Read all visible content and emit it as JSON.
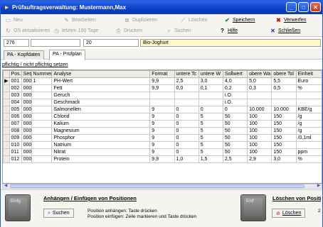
{
  "window": {
    "title": "Prüfauftragsverwaltung:  Mustermann,Max"
  },
  "toolbar": {
    "row1": [
      {
        "label": "Neu",
        "icon": "new-icon",
        "enabled": false
      },
      {
        "label": "Bearbeiten",
        "icon": "edit-icon",
        "enabled": false
      },
      {
        "label": "Duplizieren",
        "icon": "duplicate-icon",
        "enabled": false
      },
      {
        "label": "Löschen",
        "icon": "delete-icon",
        "enabled": false
      },
      {
        "label": "Speichern",
        "icon": "checkmark-icon",
        "enabled": true
      },
      {
        "label": "Verwerfen",
        "icon": "discard-icon",
        "enabled": true
      }
    ],
    "row2": [
      {
        "label": "OS aktualisieren",
        "icon": "refresh-icon",
        "enabled": false
      },
      {
        "label": "letzten 100 Tage",
        "icon": "clock-icon",
        "enabled": false
      },
      {
        "label": "Drucken",
        "icon": "print-icon",
        "enabled": false
      },
      {
        "label": "Suchen",
        "icon": "search-icon",
        "enabled": false
      },
      {
        "label": "Hilfe",
        "icon": "help-icon",
        "enabled": true
      },
      {
        "label": "Schließen",
        "icon": "close-icon",
        "enabled": true
      }
    ]
  },
  "fields": {
    "f1": "276",
    "f2": "",
    "f3": "20",
    "f4": "Bio-Joghurt"
  },
  "tabs": [
    {
      "label": "PA - Kopfdaten",
      "active": false
    },
    {
      "label": "PA - Prüfplan",
      "active": true
    }
  ],
  "sublabel": "pflichtig / nicht pflichtig setzen",
  "table": {
    "headers": [
      "Pos.",
      "Setpc",
      "Nummer",
      "Analyse",
      "Format",
      "untere Tc",
      "untere W",
      "Sollwert",
      "obere Wa",
      "obere Tol",
      "Einheit"
    ],
    "rows": [
      [
        "001",
        "000 1",
        "1",
        "PH-Wert",
        "9,9",
        "2,5",
        "3,0",
        "4,0",
        "5,0",
        "5,5",
        "Euro"
      ],
      [
        "002",
        "000 29",
        "",
        "Fett",
        "9,9",
        "0,0",
        "0,1",
        "0,2",
        "0,3",
        "0,5",
        "%"
      ],
      [
        "003",
        "000 33",
        "",
        "Geruch",
        "",
        "",
        "",
        "i.O.",
        "",
        "",
        ""
      ],
      [
        "004",
        "000 35",
        "",
        "Geschmack",
        "",
        "",
        "",
        "i.O.",
        "",
        "",
        ""
      ],
      [
        "005",
        "000 16",
        "",
        "Salmonellen",
        "9",
        "0",
        "0",
        "0",
        "10.000",
        "10.000",
        "KBE/g"
      ],
      [
        "006",
        "000 52",
        "",
        "Chlorid",
        "9",
        "0",
        "5",
        "50",
        "100",
        "150",
        "/g"
      ],
      [
        "007",
        "000 37",
        "",
        "Kalium",
        "9",
        "0",
        "5",
        "50",
        "100",
        "150",
        "/g"
      ],
      [
        "008",
        "000 39",
        "",
        "Magnesium",
        "9",
        "0",
        "5",
        "50",
        "100",
        "150",
        "/g"
      ],
      [
        "009",
        "000 46",
        "",
        "Phosphor",
        "9",
        "0",
        "5",
        "50",
        "100",
        "150",
        "/0,1ml"
      ],
      [
        "010",
        "000 41",
        "",
        "Natrium",
        "9",
        "0",
        "5",
        "50",
        "100",
        "150",
        ""
      ],
      [
        "011",
        "000 42",
        "",
        "Nitrat",
        "9",
        "0",
        "5",
        "50",
        "100",
        "150",
        "ppm"
      ],
      [
        "012",
        "000 47",
        "",
        "Protein",
        "9,9",
        "1,0",
        "1,5",
        "2,5",
        "2,9",
        "3,0",
        "%"
      ]
    ]
  },
  "bottom": {
    "left_key": "Einfg",
    "left_title": "Anhängen / Einfügen von Positionen",
    "left_button": "Suchen",
    "left_text_1": "Position anhängen: Taste drücken",
    "left_text_2": "Position einfügen: Zeile markieren und Taste drücken",
    "right_key": "Entf",
    "right_title": "Löschen von Positionen",
    "right_button": "Löschen",
    "right_digit": "2"
  },
  "colors": {
    "titlebar": "#0a3fc8",
    "field_highlight": "#fff8c8",
    "save": "#0a8a1a",
    "discard": "#d01010",
    "close": "#1020d0"
  }
}
